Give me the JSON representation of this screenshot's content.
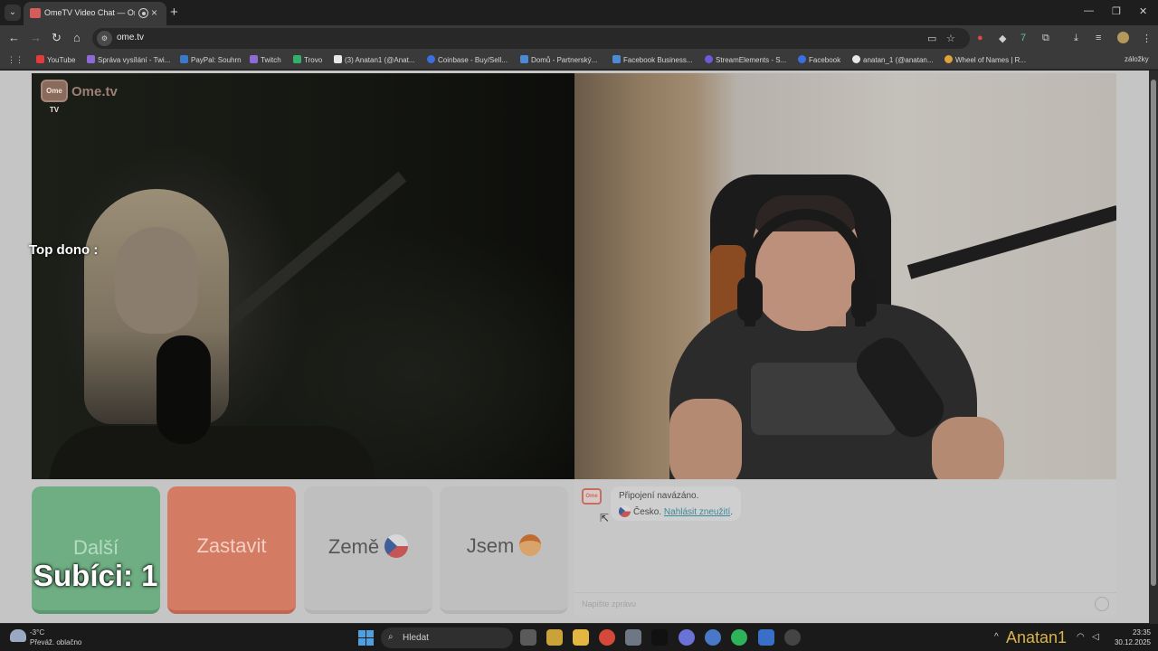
{
  "browser": {
    "tab_title": "OmeTV Video Chat — Ome",
    "url": "ome.tv",
    "bookmarks": [
      {
        "label": "YouTube",
        "color": "#e23b3b"
      },
      {
        "label": "Správa vysílání - Twi...",
        "color": "#8e6ad6"
      },
      {
        "label": "PayPal: Souhrn",
        "color": "#3a78c9"
      },
      {
        "label": "Twitch",
        "color": "#8e6ad6"
      },
      {
        "label": "Trovo",
        "color": "#33b06a"
      },
      {
        "label": "(3) Anatan1 (@Anat...",
        "color": "#e8e8e8"
      },
      {
        "label": "Coinbase - Buy/Sell...",
        "color": "#3b6fe0"
      },
      {
        "label": "Domů - Partnerský...",
        "color": "#4d8ad6"
      },
      {
        "label": "Facebook Business...",
        "color": "#4d8ad6"
      },
      {
        "label": "StreamElements - S...",
        "color": "#6a5bd6"
      },
      {
        "label": "Facebook",
        "color": "#3b6fe0"
      },
      {
        "label": "anatan_1 (@anatan...",
        "color": "#e8e8e8"
      },
      {
        "label": "Wheel of Names | R...",
        "color": "#e0a33a"
      }
    ],
    "bookmarks_more": "záložky"
  },
  "page": {
    "logo_text": "Ome.tv",
    "logo_badge": "Ome TV",
    "overlay_top_dono": "Top dono :",
    "controls": {
      "next": "Další",
      "stop": "Zastavit",
      "country": "Země",
      "gender": "Jsem"
    },
    "overlay_subs": "Subíci: 1",
    "chat": {
      "connected": "Připojení navázáno.",
      "country": "Česko.",
      "report_link": "Nahlásit zneužití",
      "report_suffix": ".",
      "input_placeholder": "Napište zprávu"
    }
  },
  "taskbar": {
    "weather_temp": "-3°C",
    "weather_desc": "Převáž. oblačno",
    "search_label": "Hledat",
    "time": "23:35",
    "date": "30.12.2025",
    "watermark": "Anatan1"
  },
  "colors": {
    "next_button": "#6fae83",
    "stop_button": "#d47b63",
    "neutral_button": "#bfbfbf",
    "link": "#3b8a9a"
  }
}
